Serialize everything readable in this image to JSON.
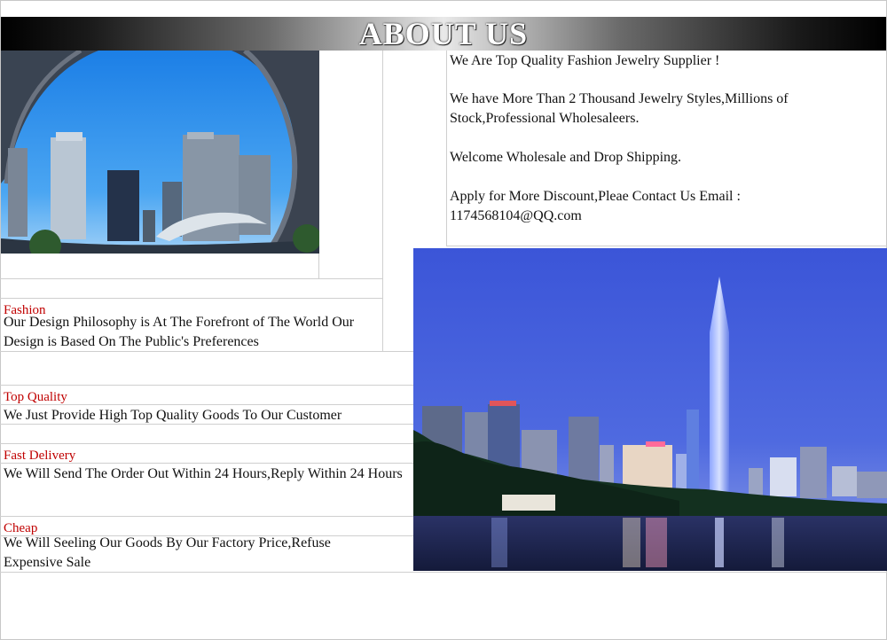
{
  "banner": {
    "title": "ABOUT US"
  },
  "intro": {
    "line1": "We Are Top Quality Fashion Jewelry Supplier !",
    "line2a": "We have More Than 2 Thousand Jewelry Styles,Millions of",
    "line2b": "Stock,Professional Wholesaleers.",
    "line3": "Welcome Wholesale and Drop Shipping.",
    "line4a": "Apply for More Discount,Pleae Contact Us Email :",
    "line4b": "1174568104@QQ.com"
  },
  "features": [
    {
      "title": "Fashion",
      "text1": "Our Design Philosophy is At The Forefront of The World Our",
      "text2": "Design is Based On The Public's Preferences"
    },
    {
      "title": "Top Quality",
      "text1": "We Just Provide High Top Quality Goods To Our Customer"
    },
    {
      "title": "Fast Delivery",
      "text1": "We Will Send The Order Out Within 24 Hours,Reply Within 24 Hours"
    },
    {
      "title": "Cheap",
      "text1": "We Will Seeling Our Goods By Our Factory Price,Refuse",
      "text2": "Expensive Sale"
    }
  ],
  "colors": {
    "accent": "#c00000",
    "sky": "#2f8fe8",
    "night": "#2a3aa8"
  }
}
